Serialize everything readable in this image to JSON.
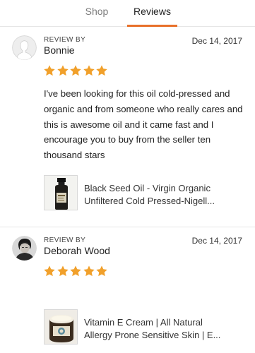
{
  "tabs": [
    {
      "label": "Shop",
      "active": false
    },
    {
      "label": "Reviews",
      "active": true
    }
  ],
  "accent_color": "#e8702a",
  "star_color": "#f1a02b",
  "reviews": [
    {
      "label": "REVIEW BY",
      "reviewer": "Bonnie",
      "date": "Dec 14, 2017",
      "rating": 5,
      "avatar_icon": "default-user-silhouette",
      "text": "I've been looking for this oil cold-pressed and organic and from someone who really cares and this is awesome oil and it came fast and I encourage you to buy from the seller ten thousand stars",
      "product": {
        "title_line1": "Black Seed Oil - Virgin Organic",
        "title_line2": "Unfiltered Cold Pressed-Nigell...",
        "thumb_icon": "oil-bottle"
      }
    },
    {
      "label": "REVIEW BY",
      "reviewer": "Deborah Wood",
      "date": "Dec 14, 2017",
      "rating": 5,
      "avatar_icon": "user-photo",
      "text": "",
      "product": {
        "title_line1": "Vitamin E Cream | All Natural",
        "title_line2": "Allergy Prone Sensitive Skin | E...",
        "thumb_icon": "cream-jar"
      }
    }
  ]
}
